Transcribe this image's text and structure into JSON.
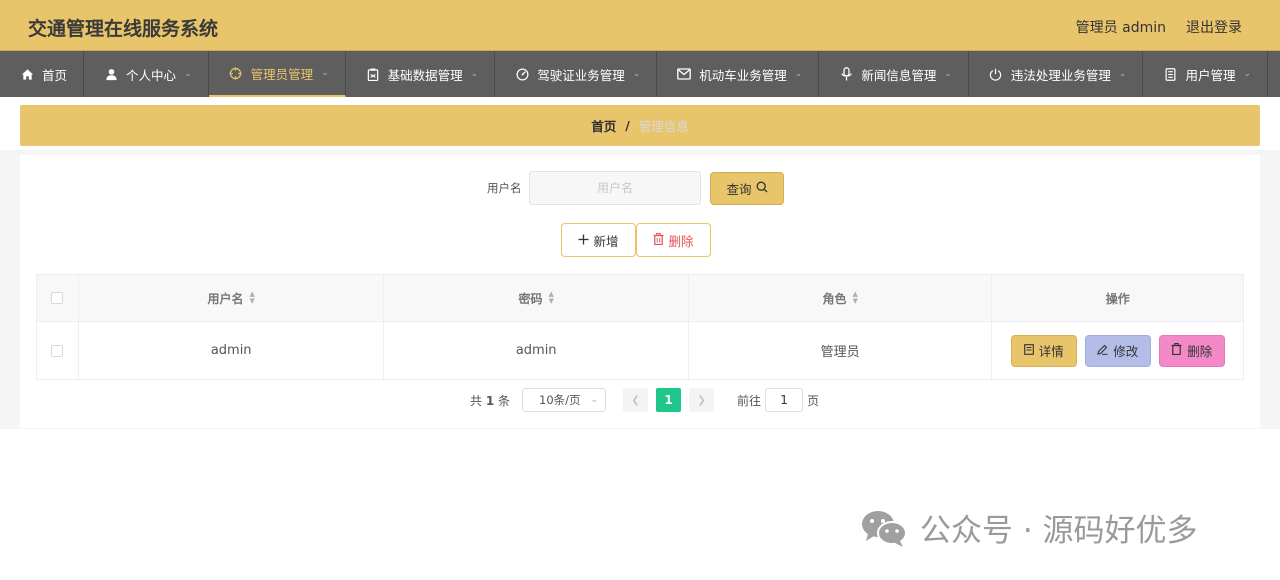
{
  "header": {
    "app_title": "交通管理在线服务系统",
    "user_label": "管理员 admin",
    "logout": "退出登录"
  },
  "nav": [
    {
      "label": "首页",
      "icon": "home-icon"
    },
    {
      "label": "个人中心",
      "icon": "user-icon"
    },
    {
      "label": "管理员管理",
      "icon": "target-icon",
      "active": true
    },
    {
      "label": "基础数据管理",
      "icon": "clipboard-icon"
    },
    {
      "label": "驾驶证业务管理",
      "icon": "gauge-icon"
    },
    {
      "label": "机动车业务管理",
      "icon": "mail-icon"
    },
    {
      "label": "新闻信息管理",
      "icon": "microphone-icon"
    },
    {
      "label": "违法处理业务管理",
      "icon": "power-icon"
    },
    {
      "label": "用户管理",
      "icon": "document-icon"
    }
  ],
  "breadcrumb": {
    "home": "首页",
    "separator": "/",
    "current": "管理信息"
  },
  "search": {
    "label": "用户名",
    "placeholder": "用户名",
    "query_button": "查询"
  },
  "actions": {
    "add": "新增",
    "delete": "删除"
  },
  "table": {
    "headers": [
      "用户名",
      "密码",
      "角色",
      "操作"
    ],
    "rows": [
      {
        "username": "admin",
        "password": "admin",
        "role": "管理员"
      }
    ],
    "row_buttons": {
      "detail": "详情",
      "edit": "修改",
      "delete": "删除"
    }
  },
  "pagination": {
    "total_prefix": "共",
    "total_count": "1",
    "total_suffix": "条",
    "page_size": "10条/页",
    "current_page": "1",
    "goto_label": "前往",
    "goto_value": "1",
    "goto_suffix": "页"
  },
  "watermark": {
    "text": "公众号 · 源码好优多"
  },
  "colors": {
    "accent": "#e8c46b",
    "nav_bg": "#5e5e5e",
    "page_active": "#1ec78a",
    "edit_button": "#b3bde8",
    "delete_button": "#f38ac7",
    "danger_text": "#e55353"
  }
}
